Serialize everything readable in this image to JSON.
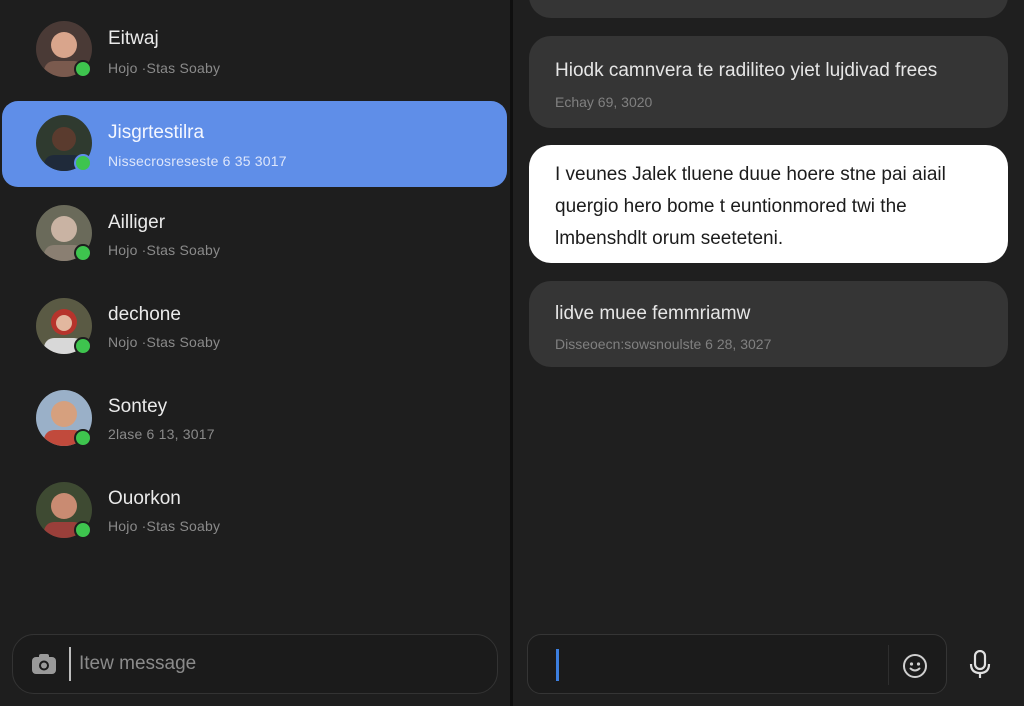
{
  "conversations": [
    {
      "name": "Eitwaj",
      "subtitle": "Hojo ·Stas Soaby",
      "selected": false
    },
    {
      "name": "Jisgrtestilra",
      "subtitle": "Nissecrosreseste 6 35 3017",
      "selected": true
    },
    {
      "name": "Ailliger",
      "subtitle": "Hojo ·Stas Soaby",
      "selected": false
    },
    {
      "name": "dechone",
      "subtitle": "Nojo ·Stas Soaby",
      "selected": false
    },
    {
      "name": "Sontey",
      "subtitle": "2lase 6 13, 3017",
      "selected": false
    },
    {
      "name": "Ouorkon",
      "subtitle": "Hojo ·Stas Soaby",
      "selected": false
    }
  ],
  "left_composer": {
    "placeholder": "Itew message"
  },
  "messages": [
    {
      "text": "Hiodk camnvera te radiliteo yiet lujdivad frees",
      "meta": "Echay 69, 3020",
      "style": "dark"
    },
    {
      "text": "I veunes Jalek tluene duue hoere stne pai aiail quergio hero bome t euntionmored twi the lmbenshdlt orum seeteteni.",
      "meta": "",
      "style": "light"
    },
    {
      "text": "lidve muee femmriamw",
      "meta": "Disseoecn:sowsnoulste 6 28, 3027",
      "style": "dark"
    }
  ],
  "right_composer": {
    "placeholder": ""
  },
  "colors": {
    "accent": "#5f8ee8",
    "online": "#3ec44e",
    "caret": "#3c7fe0"
  }
}
